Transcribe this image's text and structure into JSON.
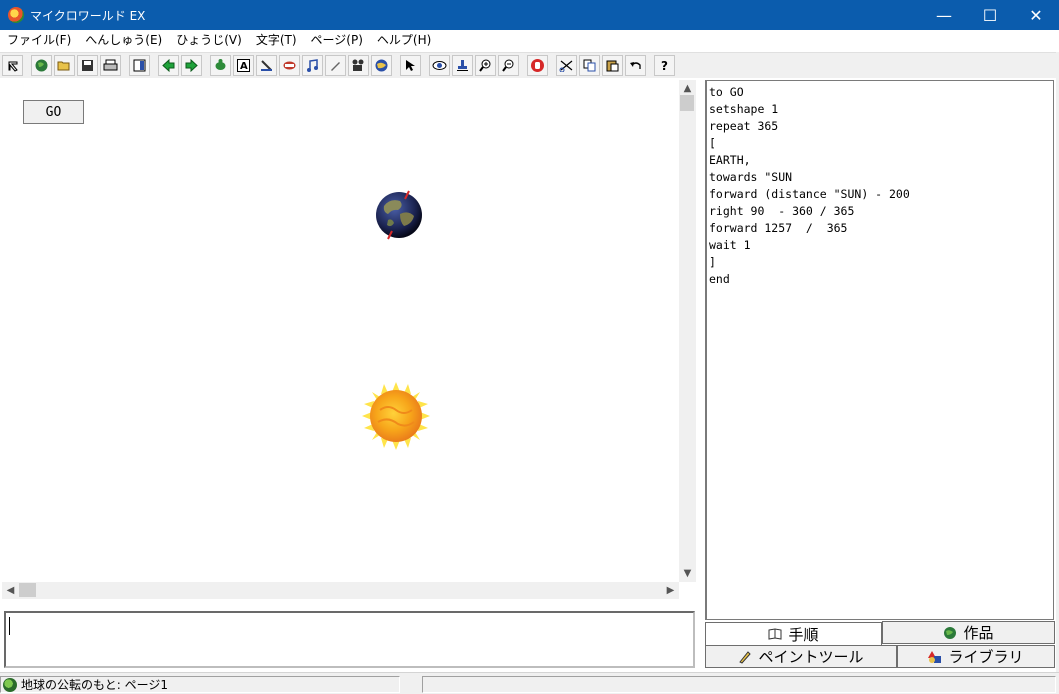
{
  "window": {
    "title": "マイクロワールド EX",
    "minimize": "—",
    "maximize": "☐",
    "close": "✕"
  },
  "menu": [
    {
      "label": "ファイル(F)"
    },
    {
      "label": "へんしゅう(E)"
    },
    {
      "label": "ひょうじ(V)"
    },
    {
      "label": "文字(T)"
    },
    {
      "label": "ページ(P)"
    },
    {
      "label": "ヘルプ(H)"
    }
  ],
  "toolbar": {
    "icons": [
      "pointer-icon",
      "globe-icon",
      "open-folder-icon",
      "save-icon",
      "print-icon",
      "layout-icon",
      "back-arrow-icon",
      "forward-arrow-icon",
      "turtle-hatch-icon",
      "text-box-icon",
      "paint-icon",
      "slider-icon",
      "music-note-icon",
      "pen-icon",
      "movie-icon",
      "world-icon",
      "arrow-pointer-icon",
      "eye-icon",
      "stamp-icon",
      "zoom-in-icon",
      "zoom-out-icon",
      "stop-hand-icon",
      "scissors-icon",
      "copy-icon",
      "paste-icon",
      "undo-icon",
      "help-icon"
    ],
    "help_label": "?"
  },
  "canvas": {
    "go_button_label": "GO",
    "earth_turtle": "earth-turtle",
    "sun_turtle": "sun-turtle"
  },
  "procedures": {
    "lines": [
      "to GO",
      "setshape 1",
      "repeat 365",
      "[",
      "EARTH,",
      "towards \"SUN",
      "forward (distance \"SUN) - 200",
      "right 90  - 360 / 365",
      "forward 1257  /  365",
      "wait 1",
      "]",
      "end"
    ]
  },
  "tabs": {
    "procedures_label": "手順",
    "project_label": "作品",
    "paint_tools_label": "ペイントツール",
    "library_label": "ライブラリ"
  },
  "status": {
    "text": "地球の公転のもと: ページ1"
  },
  "colors": {
    "titlebar": "#0b5cad",
    "chrome": "#f0f0f0"
  }
}
